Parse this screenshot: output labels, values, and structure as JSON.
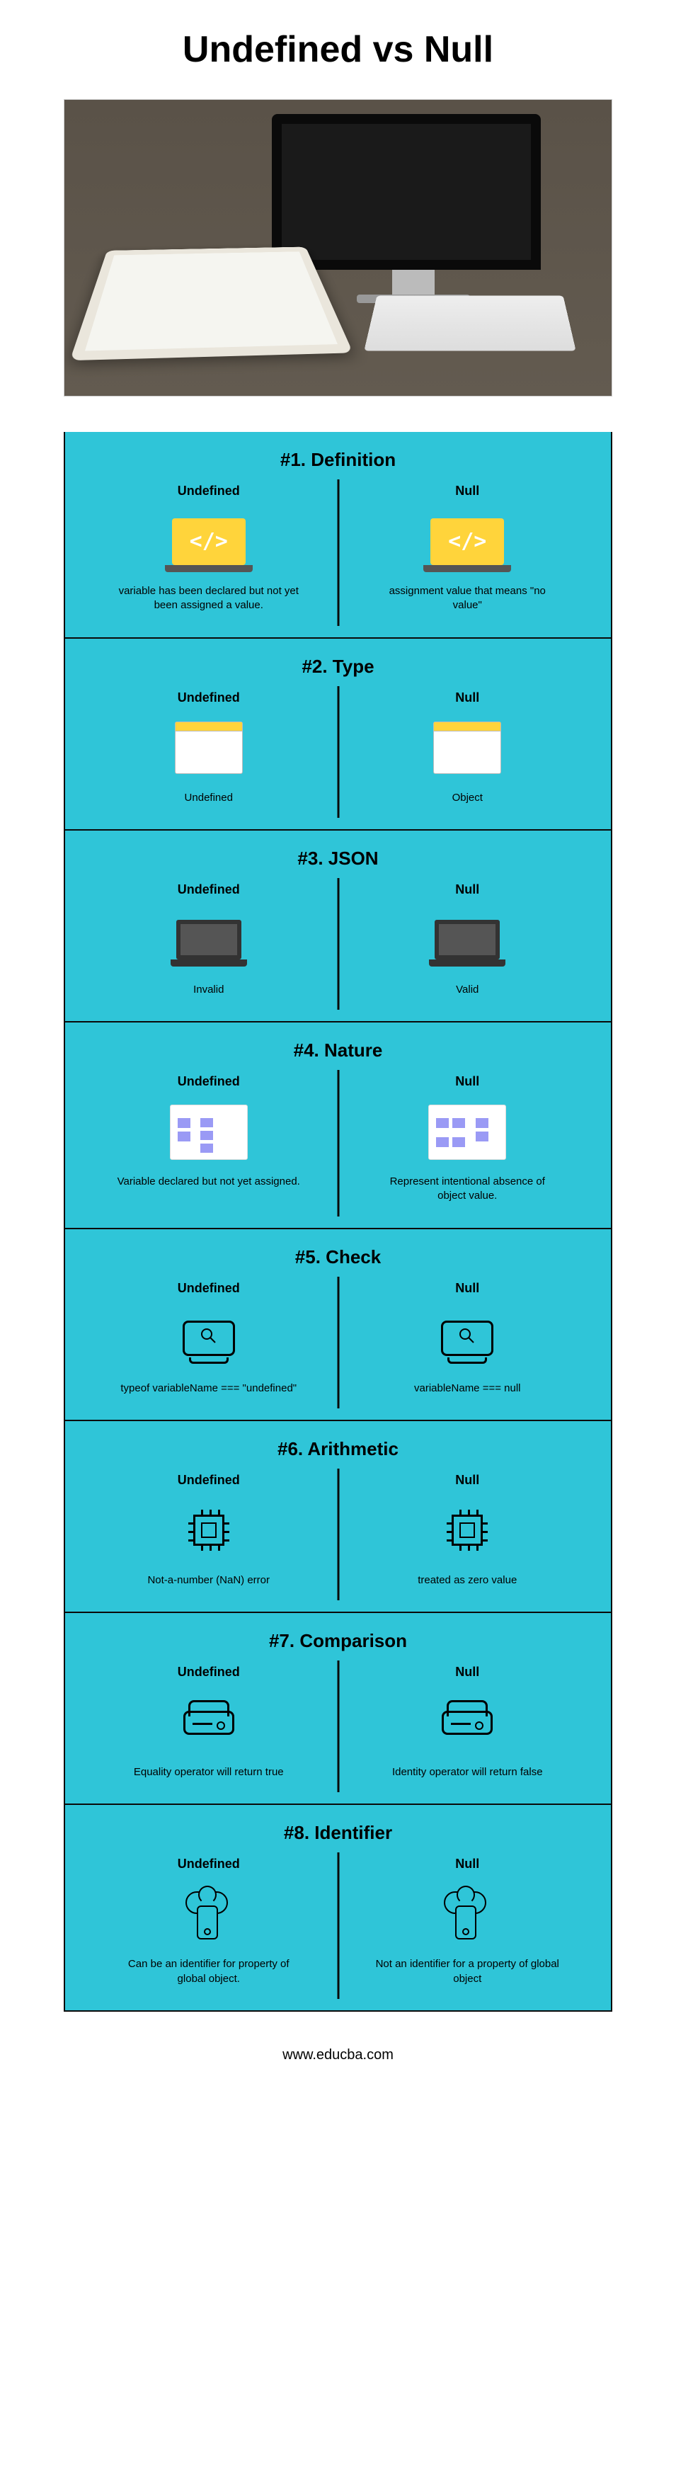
{
  "title": "Undefined vs Null",
  "labels": {
    "undefined": "Undefined",
    "null": "Null"
  },
  "sections": [
    {
      "title": "#1. Definition",
      "u": "variable has been declared but not yet been assigned a value.",
      "n": "assignment value that means \"no value\""
    },
    {
      "title": "#2. Type",
      "u": "Undefined",
      "n": "Object"
    },
    {
      "title": "#3. JSON",
      "u": "Invalid",
      "n": "Valid"
    },
    {
      "title": "#4. Nature",
      "u": "Variable declared but not yet assigned.",
      "n": "Represent intentional absence of object value."
    },
    {
      "title": "#5. Check",
      "u": "typeof variableName === \"undefined\"",
      "n": "variableName === null"
    },
    {
      "title": "#6. Arithmetic",
      "u": "Not-a-number (NaN) error",
      "n": "treated as zero value"
    },
    {
      "title": "#7. Comparison",
      "u": "Equality operator will return true",
      "n": "Identity operator will return false"
    },
    {
      "title": "#8. Identifier",
      "u": "Can be an identifier for property of global object.",
      "n": "Not an identifier for a property of global object"
    }
  ],
  "footer": "www.educba.com"
}
